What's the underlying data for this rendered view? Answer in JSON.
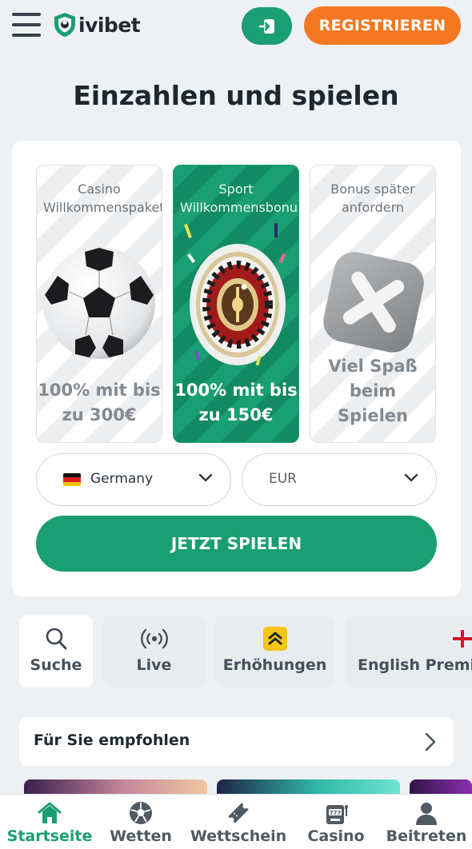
{
  "header": {
    "logo_text": "ivibet",
    "register_label": "REGISTRIEREN",
    "login_icon": "login-icon",
    "menu_icon": "hamburger-menu-icon"
  },
  "page_title": "Einzahlen und spielen",
  "bonuses": [
    {
      "title_line1": "Casino",
      "title_line2": "Willkommenspaket",
      "amount_line1": "100% mit bis",
      "amount_line2": "zu 300€",
      "image": "soccer-ball",
      "selected": false
    },
    {
      "title_line1": "Sport",
      "title_line2": "Willkommensbonus",
      "amount_line1": "100% mit bis",
      "amount_line2": "zu 150€",
      "image": "roulette-wheel",
      "selected": true
    },
    {
      "title_line1": "Bonus später",
      "title_line2": "anfordern",
      "amount_line1": "Viel Spaß",
      "amount_line2": "beim",
      "amount_line3": "Spielen",
      "image": "x-cross",
      "selected": false
    }
  ],
  "country_select": {
    "value": "Germany",
    "flag": "germany-flag"
  },
  "currency_select": {
    "value": "EUR"
  },
  "play_button": "JETZT SPIELEN",
  "quick_nav": [
    {
      "label": "Suche",
      "icon": "search-icon"
    },
    {
      "label": "Live",
      "icon": "live-broadcast-icon"
    },
    {
      "label": "Erhöhungen",
      "icon": "boost-arrows-icon"
    },
    {
      "label": "English Premier League",
      "icon": "england-flag-icon"
    }
  ],
  "recommended": {
    "label": "Für Sie empfohlen"
  },
  "bottom_nav": [
    {
      "label": "Startseite",
      "icon": "home-icon",
      "active": true
    },
    {
      "label": "Wetten",
      "icon": "soccer-ball-icon",
      "active": false
    },
    {
      "label": "Wettschein",
      "icon": "ticket-icon",
      "active": false
    },
    {
      "label": "Casino",
      "icon": "slot-machine-icon",
      "active": false
    },
    {
      "label": "Beitreten",
      "icon": "user-icon",
      "active": false
    }
  ],
  "colors": {
    "brand_green": "#1a9e73",
    "brand_orange": "#f37821",
    "background": "#eef1f4"
  }
}
